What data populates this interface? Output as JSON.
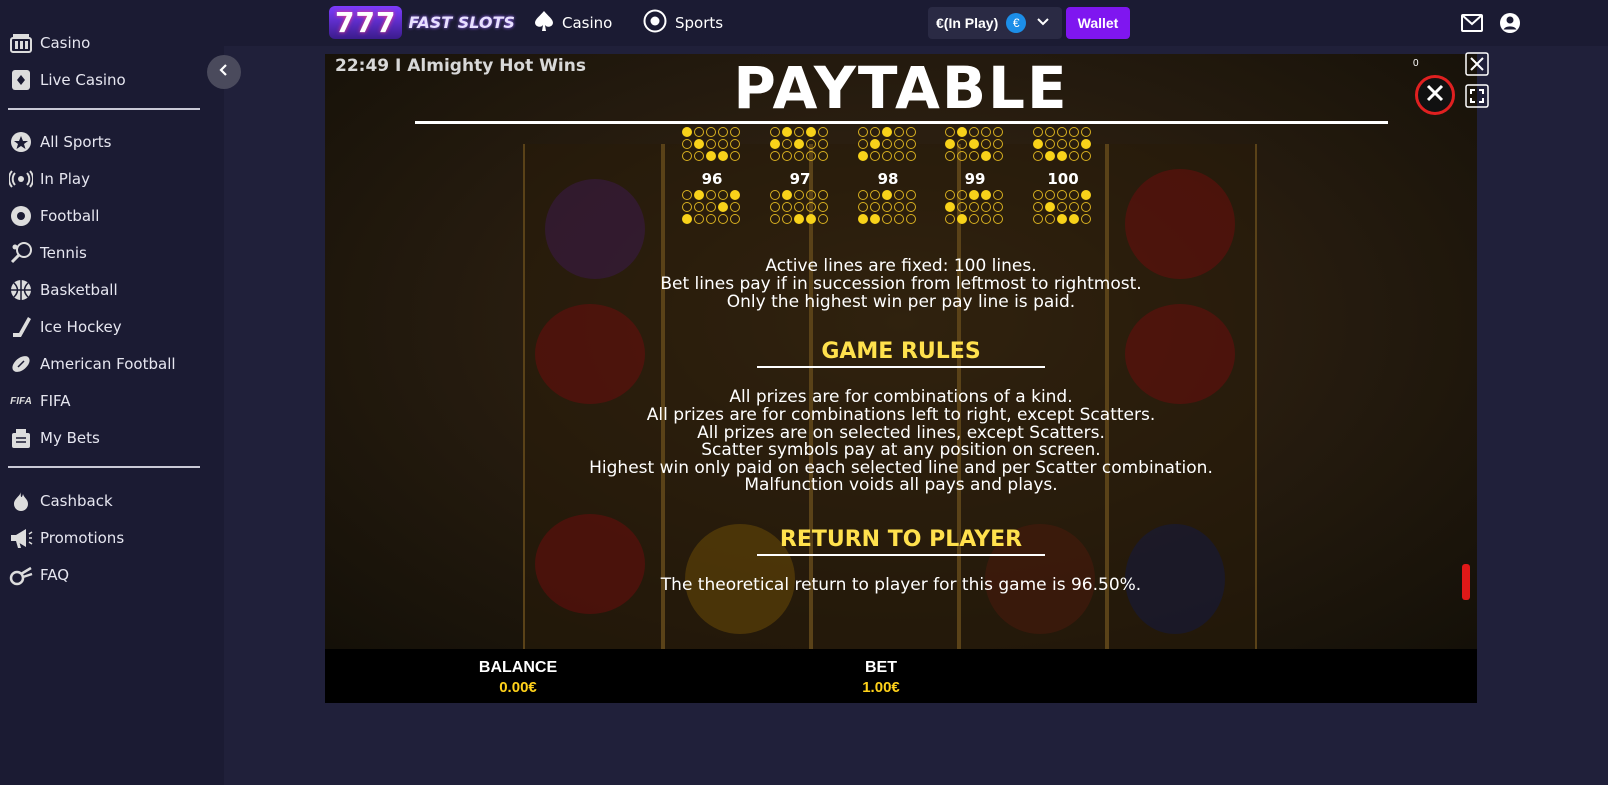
{
  "sidebar": {
    "groups": [
      [
        {
          "label": "Casino",
          "icon": "casino-icon"
        },
        {
          "label": "Live Casino",
          "icon": "live-casino-icon"
        }
      ],
      [
        {
          "label": "All Sports",
          "icon": "all-sports-icon"
        },
        {
          "label": "In Play",
          "icon": "in-play-icon"
        },
        {
          "label": "Football",
          "icon": "football-icon"
        },
        {
          "label": "Tennis",
          "icon": "tennis-icon"
        },
        {
          "label": "Basketball",
          "icon": "basketball-icon"
        },
        {
          "label": "Ice Hockey",
          "icon": "ice-hockey-icon"
        },
        {
          "label": "American Football",
          "icon": "american-football-icon"
        },
        {
          "label": "FIFA",
          "icon": "fifa-icon"
        },
        {
          "label": "My Bets",
          "icon": "my-bets-icon"
        }
      ],
      [
        {
          "label": "Cashback",
          "icon": "cashback-icon"
        },
        {
          "label": "Promotions",
          "icon": "promotions-icon"
        },
        {
          "label": "FAQ",
          "icon": "faq-icon"
        }
      ]
    ],
    "fifa_icon_text": "FIFA"
  },
  "header": {
    "logo_num": "777",
    "logo_text": "FAST SLOTS",
    "nav_casino": "Casino",
    "nav_sports": "Sports",
    "balance_label": "€(In Play)",
    "currency_symbol": "€",
    "wallet_label": "Wallet"
  },
  "game": {
    "title": "22:49 I Almighty Hot Wins",
    "counter": "0",
    "paytable_title": "PAYTABLE",
    "lines": [
      {
        "num": "96",
        "pattern": [
          [
            0,
            1,
            0,
            0,
            1
          ],
          [
            0,
            0,
            0,
            1,
            0
          ],
          [
            1,
            0,
            0,
            0,
            0
          ]
        ]
      },
      {
        "num": "97",
        "pattern": [
          [
            0,
            1,
            0,
            0,
            0
          ],
          [
            0,
            0,
            0,
            0,
            0
          ],
          [
            0,
            0,
            1,
            1,
            0
          ]
        ]
      },
      {
        "num": "98",
        "pattern": [
          [
            0,
            0,
            1,
            0,
            0
          ],
          [
            0,
            0,
            0,
            0,
            0
          ],
          [
            1,
            1,
            0,
            0,
            0
          ]
        ]
      },
      {
        "num": "99",
        "pattern": [
          [
            0,
            0,
            1,
            1,
            0
          ],
          [
            1,
            0,
            0,
            0,
            0
          ],
          [
            0,
            1,
            0,
            0,
            0
          ]
        ]
      },
      {
        "num": "100",
        "pattern": [
          [
            0,
            0,
            0,
            0,
            1
          ],
          [
            0,
            1,
            0,
            0,
            0
          ],
          [
            0,
            0,
            1,
            1,
            0
          ]
        ]
      }
    ],
    "lines_info": [
      "Active lines are fixed: 100 lines.",
      "Bet lines pay if in succession from leftmost to rightmost.",
      "Only the highest win per pay line is paid."
    ],
    "rules_heading": "GAME RULES",
    "rules": [
      "All prizes are for combinations of a kind.",
      "All prizes are for combinations left to right, except Scatters.",
      "All prizes are on selected lines, except Scatters.",
      "Scatter symbols pay at any position on screen.",
      "Highest win only paid on each selected line and per Scatter combination.",
      "Malfunction voids all pays and plays."
    ],
    "rtp_heading": "RETURN TO PLAYER",
    "rtp_text": "The theoretical return to player for this game is 96.50%.",
    "balance_label": "BALANCE",
    "balance_value": "0.00€",
    "bet_label": "BET",
    "bet_value": "1.00€"
  },
  "colors": {
    "accent": "#7f16f0",
    "heading": "#ffe14d",
    "close_ring": "#e02020"
  }
}
